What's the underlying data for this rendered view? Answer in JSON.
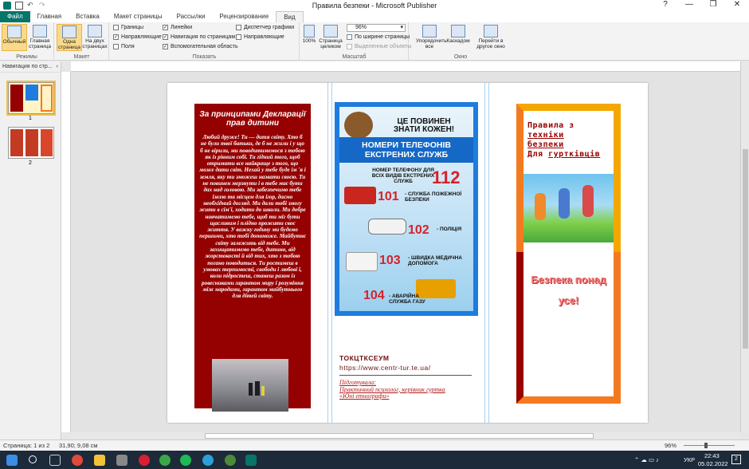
{
  "window": {
    "title": "Правила безпеки - Microsoft Publisher",
    "help": "?",
    "minimize": "—",
    "restore": "❐",
    "close": "✕"
  },
  "tabs": [
    "Файл",
    "Главная",
    "Вставка",
    "Макет страницы",
    "Рассылки",
    "Рецензирование",
    "Вид"
  ],
  "ribbon": {
    "modes": {
      "label": "Режимы",
      "normal": "Обычный",
      "master": "Главная страница"
    },
    "layout": {
      "label": "Макет",
      "one_page": "Одна страница",
      "two_pages": "На двух страницах"
    },
    "show": {
      "label": "Показать",
      "items": [
        {
          "text": "Границы",
          "checked": false
        },
        {
          "text": "Направляющие",
          "checked": true
        },
        {
          "text": "Поля",
          "checked": false
        },
        {
          "text": "Линейки",
          "checked": true
        },
        {
          "text": "Навигация по страницам",
          "checked": true
        },
        {
          "text": "Вспомогательная область",
          "checked": true
        },
        {
          "text": "Диспетчер графики",
          "checked": false
        },
        {
          "text": "Направляющие",
          "checked": false
        }
      ]
    },
    "zoom": {
      "label": "Масштаб",
      "pct100": "100%",
      "whole_page": "Страница целиком",
      "value": "96%",
      "page_width": "По ширине страницы",
      "selected_objects": "Выделенные объекты"
    },
    "window": {
      "label": "Окно",
      "arrange": "Упорядочить все",
      "cascade": "Каскадом",
      "switch": "Перейти в другое окно"
    }
  },
  "nav_panel": {
    "title": "Навигация по стр...",
    "pages": [
      "1",
      "2"
    ]
  },
  "panel1": {
    "heading": "За принципами Декларації прав дитини",
    "body": "Любий друже! Ти — дитя світу. Хто б не були твої батьки, де б не жили і у що б не вірили, ми поводитимемося з тобою як із рівним собі. Ти гідний того, щоб отримати все найкраще з того, що може дати світ. Нехай у тебе буде ім 'я і земля, яку ти зможеш назвати своєю. Ти не повинен мерзнути і в тебе має бути дах над головою. Ми забезпечимо тебе їжею та місцем для ігор, даємо необхідний догляд. Ми дали тобі змогу жити в сім'ї, ходити до школи. Ми добре навчатимемо тебе, щоб ти міг бути щасливим і плідно прожити своє життя. У важку годину ми будемо першими, хто тобі допоможе. Майбутнє світу залежить від тебе. Ми захищатимемо тебе, дитино, від жорстокості й від тих, хто з тобою погано поводиться. Ти ростимеш в умовах терпимості, свободи і любові і, коли підростеш, станеш разом із ровесниками гарантом миру і розуміння між народами, гарантом майбутнього для дітей світу."
  },
  "panel2": {
    "title": "ЦЕ ПОВИНЕН ЗНАТИ КОЖЕН!",
    "band": "НОМЕРИ ТЕЛЕФОНІВ ЕКСТРЕНИХ СЛУЖБ",
    "general": "НОМЕР ТЕЛЕФОНУ ДЛЯ ВСІХ ВИДІВ ЕКСТРЕНИХ СЛУЖБ",
    "general_number": "112",
    "services": [
      {
        "number": "101",
        "label": "- СЛУЖБА ПОЖЕЖНОЇ БЕЗПЕКИ"
      },
      {
        "number": "102",
        "label": "- ПОЛІЦІЯ"
      },
      {
        "number": "103",
        "label": "- ШВИДКА МЕДИЧНА ДОПОМОГА"
      },
      {
        "number": "104",
        "label": "- АВАРІЙНА СЛУЖБА ГАЗУ"
      }
    ],
    "org": "ТОКЦТКСЕУМ",
    "url": "https://www.centr-tur.te.ua/",
    "prepared": "Підготувала:",
    "author": "Практичний психолог, керівник гуртка «Юні етнографи»"
  },
  "panel3": {
    "line1": "Правила з",
    "line2": "техніки",
    "line3": "безпеки",
    "line4_a": "Для ",
    "line4_b": "гуртківців",
    "slogan_1": "Безпека понад",
    "slogan_2": "усе!"
  },
  "status": {
    "page": "Страница: 1 из 2",
    "position": "31,90; 9,08 см",
    "zoom": "96%"
  },
  "taskbar": {
    "lang": "УКР",
    "time": "22:43",
    "date": "05.02.2022",
    "notif": "2"
  },
  "colors": {
    "accent": "#077568",
    "panel1_bg": "#950000",
    "frame_blue": "#1e7be0"
  }
}
